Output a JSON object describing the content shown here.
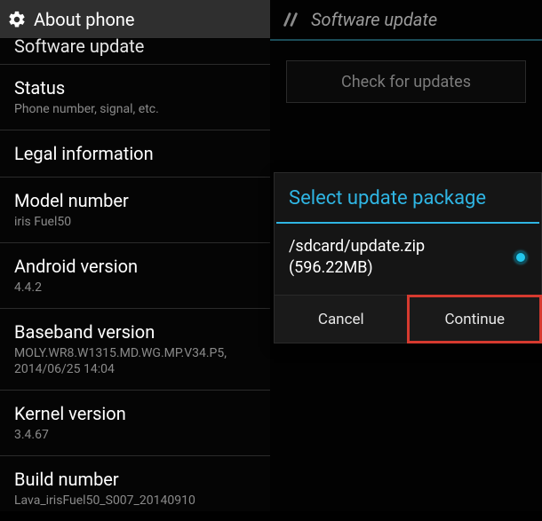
{
  "left": {
    "header_title": "About phone",
    "clipped_item_title": "Software update",
    "items": [
      {
        "title": "Status",
        "subtitle": "Phone number, signal, etc."
      },
      {
        "title": "Legal information",
        "subtitle": ""
      },
      {
        "title": "Model number",
        "subtitle": "iris Fuel50"
      },
      {
        "title": "Android version",
        "subtitle": "4.4.2"
      },
      {
        "title": "Baseband version",
        "subtitle": "MOLY.WR8.W1315.MD.WG.MP.V34.P5, 2014/06/25 14:04"
      },
      {
        "title": "Kernel version",
        "subtitle": "3.4.67"
      },
      {
        "title": "Build number",
        "subtitle": "Lava_irisFuel50_S007_20140910"
      }
    ]
  },
  "right": {
    "header_title": "Software update",
    "check_button": "Check for updates",
    "dialog": {
      "title": "Select update package",
      "package_path": "/sdcard/update.zip",
      "package_size": "(596.22MB)",
      "cancel": "Cancel",
      "continue": "Continue"
    }
  }
}
